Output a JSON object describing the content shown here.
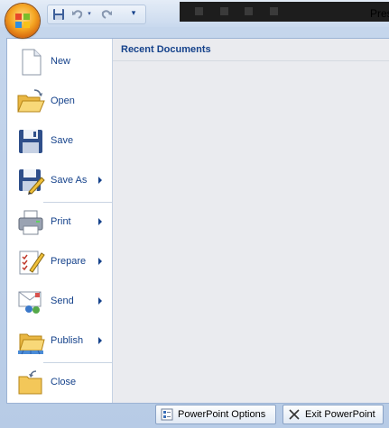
{
  "titlebar": {
    "title": "Pres"
  },
  "quick_access": {
    "items": [
      "save-icon",
      "undo-icon",
      "redo-icon",
      "customize-icon"
    ]
  },
  "recent": {
    "title": "Recent Documents"
  },
  "commands": [
    {
      "label": "New",
      "icon": "new-document-icon",
      "submenu": false
    },
    {
      "label": "Open",
      "icon": "open-folder-icon",
      "submenu": false
    },
    {
      "label": "Save",
      "icon": "save-disk-icon",
      "submenu": false
    },
    {
      "label": "Save As",
      "icon": "save-as-icon",
      "submenu": true
    },
    {
      "label": "Print",
      "icon": "printer-icon",
      "submenu": true
    },
    {
      "label": "Prepare",
      "icon": "prepare-icon",
      "submenu": true
    },
    {
      "label": "Send",
      "icon": "send-icon",
      "submenu": true
    },
    {
      "label": "Publish",
      "icon": "publish-icon",
      "submenu": true
    },
    {
      "label": "Close",
      "icon": "close-folder-icon",
      "submenu": false
    }
  ],
  "footer": {
    "options_label": "PowerPoint Options",
    "exit_label": "Exit PowerPoint"
  },
  "colors": {
    "accent": "#15428b",
    "panel": "#eaebef"
  }
}
